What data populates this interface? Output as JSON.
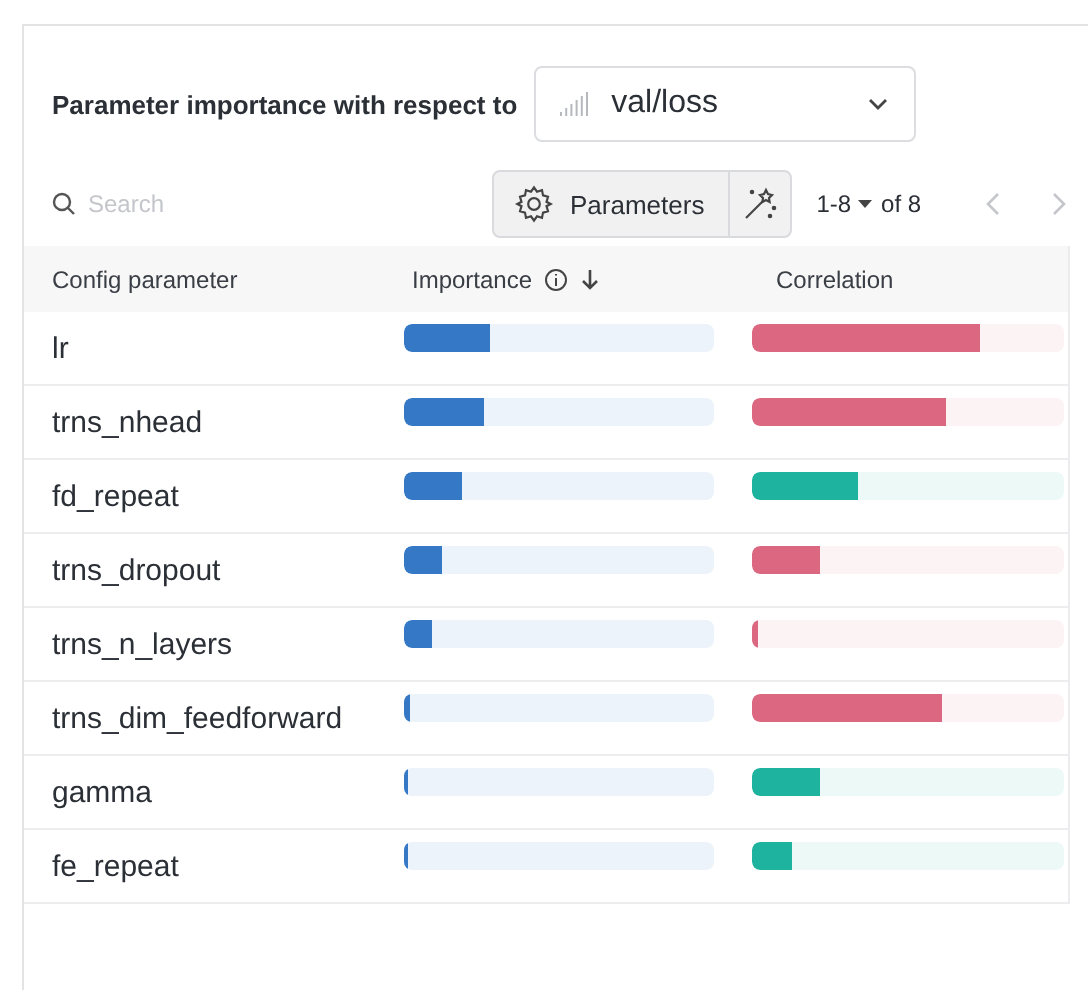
{
  "header": {
    "label": "Parameter importance with respect to",
    "metric": "val/loss"
  },
  "toolbar": {
    "search_placeholder": "Search",
    "parameters_button": "Parameters",
    "page_range": "1-8",
    "page_total": "of 8"
  },
  "table": {
    "columns": [
      "Config parameter",
      "Importance",
      "Correlation"
    ],
    "rows": [
      {
        "name": "lr",
        "importance": {
          "level": 0.28
        },
        "correlation": {
          "level": 0.73,
          "color": "#db6780"
        }
      },
      {
        "name": "trns_nhead",
        "importance": {
          "level": 0.26
        },
        "correlation": {
          "level": 0.62,
          "color": "#db6780"
        }
      },
      {
        "name": "fd_repeat",
        "importance": {
          "level": 0.19
        },
        "correlation": {
          "level": 0.34,
          "color": "#1db39f"
        }
      },
      {
        "name": "trns_dropout",
        "importance": {
          "level": 0.12
        },
        "correlation": {
          "level": 0.22,
          "color": "#db6780"
        }
      },
      {
        "name": "trns_n_layers",
        "importance": {
          "level": 0.09
        },
        "correlation": {
          "level": 0.02,
          "color": "#db6780"
        }
      },
      {
        "name": "trns_dim_feedforward",
        "importance": {
          "level": 0.02
        },
        "correlation": {
          "level": 0.61,
          "color": "#db6780"
        }
      },
      {
        "name": "gamma",
        "importance": {
          "level": 0.015
        },
        "correlation": {
          "level": 0.22,
          "color": "#1db39f"
        }
      },
      {
        "name": "fe_repeat",
        "importance": {
          "level": 0.01
        },
        "correlation": {
          "level": 0.13,
          "color": "#1db39f"
        }
      }
    ]
  }
}
